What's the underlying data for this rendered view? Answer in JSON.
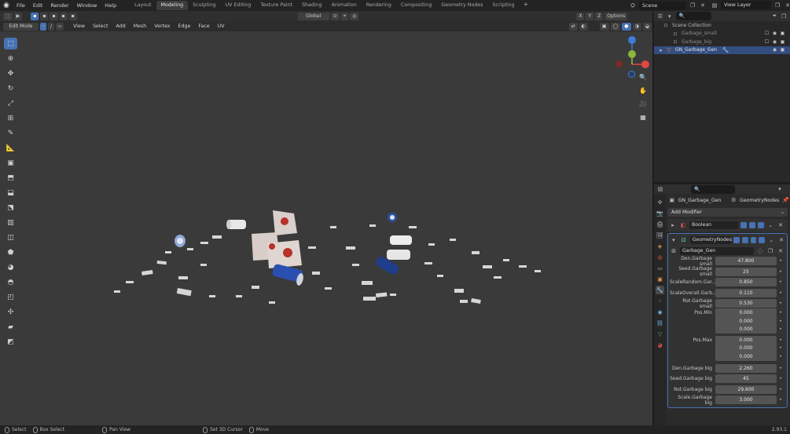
{
  "menu": [
    "File",
    "Edit",
    "Render",
    "Window",
    "Help"
  ],
  "workspace_tabs": [
    {
      "label": "Layout",
      "active": false
    },
    {
      "label": "Modeling",
      "active": true
    },
    {
      "label": "Sculpting",
      "active": false
    },
    {
      "label": "UV Editing",
      "active": false
    },
    {
      "label": "Texture Paint",
      "active": false
    },
    {
      "label": "Shading",
      "active": false
    },
    {
      "label": "Animation",
      "active": false
    },
    {
      "label": "Rendering",
      "active": false
    },
    {
      "label": "Compositing",
      "active": false
    },
    {
      "label": "Geometry Nodes",
      "active": false
    },
    {
      "label": "Scripting",
      "active": false
    }
  ],
  "scene_name": "Scene",
  "view_layer": "View Layer",
  "viewport": {
    "mode": "Edit Mode",
    "menus": [
      "View",
      "Select",
      "Add",
      "Mesh",
      "Vertex",
      "Edge",
      "Face",
      "UV"
    ],
    "transform_orientation": "Global",
    "options_label": "Options",
    "axis_labels": [
      "X",
      "Y",
      "Z"
    ]
  },
  "outliner": {
    "collection": "Scene Collection",
    "items": [
      {
        "name": "Garbage_small",
        "selected": false
      },
      {
        "name": "Garbage_big",
        "selected": false
      },
      {
        "name": "GN_Garbage_Gen",
        "selected": true
      }
    ]
  },
  "properties": {
    "object_name": "GN_Garbage_Gen",
    "modifier_label": "GeometryNodes",
    "add_modifier": "Add Modifier",
    "modifiers": [
      {
        "name": "Boolean",
        "type": "boolean-icon"
      },
      {
        "name": "GeometryNodes",
        "type": "geometry-nodes-icon"
      }
    ],
    "node_group": "Garbage_Gen",
    "params": [
      {
        "label": "Den.Garbage small",
        "value": "47.800"
      },
      {
        "label": "Seed.Garbage small",
        "value": "25"
      },
      {
        "label": "ScaleRandom.Gar...",
        "value": "0.850"
      },
      {
        "label": "ScaleOverall.Garb...",
        "value": "0.110"
      },
      {
        "label": "Rot.Garbage small",
        "value": "0.530"
      }
    ],
    "pos_min": {
      "label": "Pos.Min",
      "values": [
        "0.000",
        "0.000",
        "0.000"
      ]
    },
    "pos_max": {
      "label": "Pos.Max",
      "values": [
        "0.000",
        "0.000",
        "0.000"
      ]
    },
    "params_big": [
      {
        "label": "Den.Garbage big",
        "value": "2.260"
      },
      {
        "label": "Seed.Garbage big",
        "value": "45"
      },
      {
        "label": "Rot.Garbage big",
        "value": "29.600"
      },
      {
        "label": "Scale.Garbage big",
        "value": "3.000"
      }
    ]
  },
  "statusbar": {
    "items": [
      "Select",
      "Box Select",
      "Pan View",
      "Set 3D Cursor",
      "Move"
    ],
    "version": "2.93.1"
  },
  "colors": {
    "accent": "#4772b3",
    "viewport_bg": "#3a3a3a",
    "panel_bg": "#2b2b2b",
    "axis_x": "#e2473f",
    "axis_y": "#8bb73a",
    "axis_z": "#3f7bd6"
  }
}
